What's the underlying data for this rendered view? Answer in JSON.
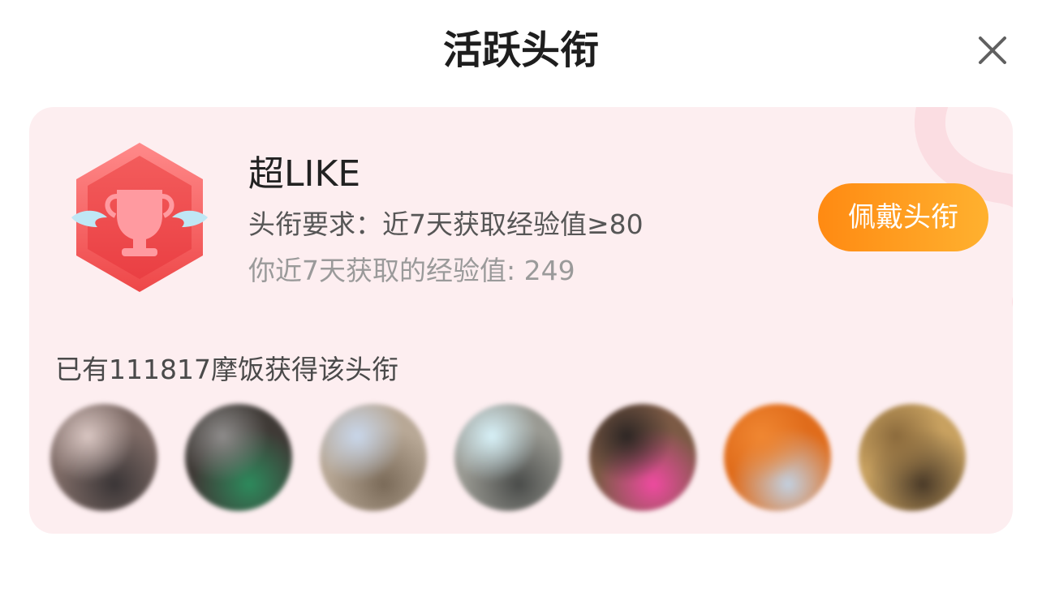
{
  "dialog": {
    "title": "活跃头衔",
    "close_icon": "close-icon"
  },
  "badge": {
    "icon": "trophy-badge-icon",
    "name": "超LIKE",
    "requirement": "头衔要求：近7天获取经验值≥80",
    "user_exp": "你近7天获取的经验值: 249",
    "wear_label": "佩戴头衔",
    "owners_text": "已有111817摩饭获得该头衔"
  },
  "avatars": [
    {
      "name": "avatar-1",
      "colors": [
        "#d9c6c2",
        "#3a3536",
        "#7e6b66"
      ]
    },
    {
      "name": "avatar-2",
      "colors": [
        "#8e8c8b",
        "#2d8a5c",
        "#3f3a36"
      ]
    },
    {
      "name": "avatar-3",
      "colors": [
        "#c8d6ea",
        "#7a6a58",
        "#b8a896"
      ]
    },
    {
      "name": "avatar-4",
      "colors": [
        "#d7f1f8",
        "#4a4c4a",
        "#9a9a93"
      ]
    },
    {
      "name": "avatar-5",
      "colors": [
        "#2d2624",
        "#ef4aa0",
        "#7c5a45"
      ]
    },
    {
      "name": "avatar-6",
      "colors": [
        "#f08732",
        "#c2d0e0",
        "#e06c1b"
      ]
    },
    {
      "name": "avatar-7",
      "colors": [
        "#8b6a3c",
        "#4a3a28",
        "#c8a160"
      ]
    }
  ],
  "colors": {
    "accent": "#ff9a1e",
    "card_bg": "#fdeef0",
    "badge_red": "#f2534f"
  }
}
